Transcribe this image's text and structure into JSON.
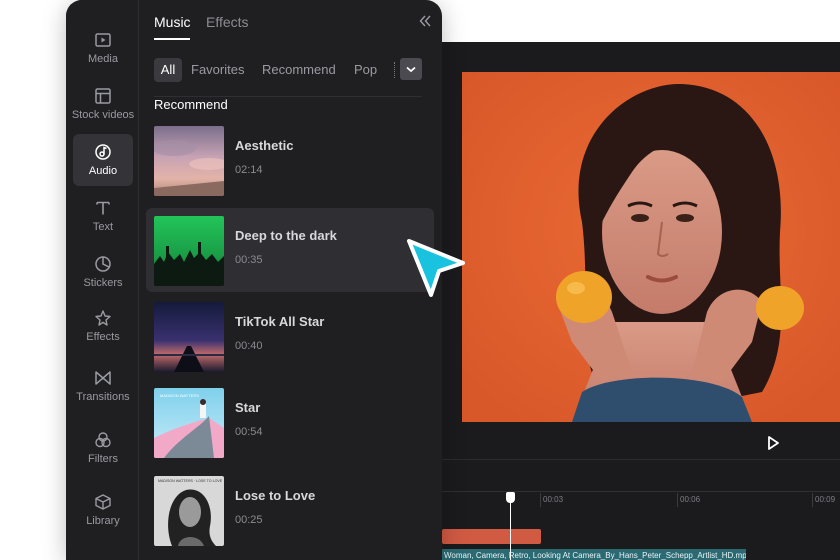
{
  "panel": {
    "tabs": {
      "music": "Music",
      "effects": "Effects"
    },
    "filters": {
      "all": "All",
      "favorites": "Favorites",
      "recommend": "Recommend",
      "pop": "Pop"
    },
    "section_title": "Recommend",
    "tracks": [
      {
        "title": "Aesthetic",
        "duration": "02:14"
      },
      {
        "title": "Deep to the dark",
        "duration": "00:35"
      },
      {
        "title": "TikTok All Star",
        "duration": "00:40"
      },
      {
        "title": "Star",
        "duration": "00:54"
      },
      {
        "title": "Lose to Love",
        "duration": "00:25"
      }
    ],
    "thumb_texts": {
      "star_artist": "MADISON WATTERS",
      "lose_header": "MADISON WATTERS · LOSE TO LOVE"
    }
  },
  "sidebar": {
    "items": [
      {
        "label": "Media"
      },
      {
        "label": "Stock videos"
      },
      {
        "label": "Audio"
      },
      {
        "label": "Text"
      },
      {
        "label": "Stickers"
      },
      {
        "label": "Effects"
      },
      {
        "label": "Transitions"
      },
      {
        "label": "Filters"
      },
      {
        "label": "Library"
      }
    ],
    "active": "Audio"
  },
  "timeline": {
    "ticks": [
      "00:03",
      "00:06",
      "00:09"
    ],
    "video_clip_label": "Woman, Camera, Retro, Looking At Camera_By_Hans_Peter_Schepp_Artlist_HD.mp"
  },
  "colors": {
    "panel_bg": "#1f1f22",
    "preview_bg": "#e2602c",
    "audio_clip": "#d15a43",
    "video_clip": "#2b6a73",
    "cursor": "#19c3e0"
  }
}
